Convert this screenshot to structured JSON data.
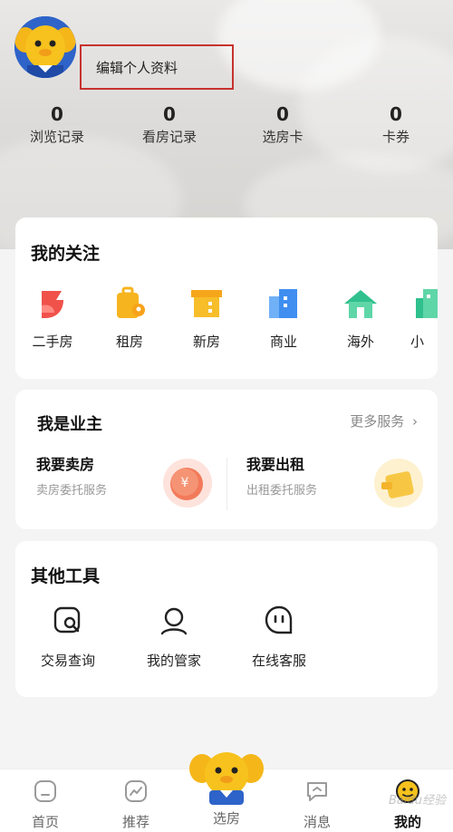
{
  "profile": {
    "edit_label": "编辑个人资料"
  },
  "stats": [
    {
      "value": "0",
      "label": "浏览记录"
    },
    {
      "value": "0",
      "label": "看房记录"
    },
    {
      "value": "0",
      "label": "选房卡"
    },
    {
      "value": "0",
      "label": "卡券"
    }
  ],
  "favorites": {
    "title": "我的关注",
    "items": [
      {
        "label": "二手房",
        "icon": "second-hand-house-icon",
        "color": "#f0524a"
      },
      {
        "label": "租房",
        "icon": "rental-suitcase-icon",
        "color": "#f6b41e"
      },
      {
        "label": "新房",
        "icon": "new-house-box-icon",
        "color": "#f6a61b"
      },
      {
        "label": "商业",
        "icon": "commercial-building-icon",
        "color": "#3f8ef0"
      },
      {
        "label": "海外",
        "icon": "overseas-house-icon",
        "color": "#2fc08e"
      },
      {
        "label": "小",
        "icon": "small-building-icon",
        "color": "#2fc08e"
      }
    ]
  },
  "owner": {
    "title": "我是业主",
    "more_label": "更多服务",
    "sell": {
      "title": "我要卖房",
      "subtitle": "卖房委托服务"
    },
    "rent": {
      "title": "我要出租",
      "subtitle": "出租委托服务"
    }
  },
  "tools": {
    "title": "其他工具",
    "items": [
      {
        "label": "交易查询",
        "icon": "transaction-search-icon"
      },
      {
        "label": "我的管家",
        "icon": "butler-person-icon"
      },
      {
        "label": "在线客服",
        "icon": "chat-service-icon"
      }
    ]
  },
  "tabbar": [
    {
      "label": "首页",
      "icon": "home-icon"
    },
    {
      "label": "推荐",
      "icon": "recommend-trend-icon"
    },
    {
      "label": "选房",
      "icon": "mascot-icon"
    },
    {
      "label": "消息",
      "icon": "message-icon"
    },
    {
      "label": "我的",
      "icon": "mine-icon"
    }
  ],
  "watermark": "Baidu经验",
  "colors": {
    "accent_red": "#c8322f",
    "mascot_yellow": "#f7c21d",
    "mascot_blue": "#2e63c9"
  }
}
